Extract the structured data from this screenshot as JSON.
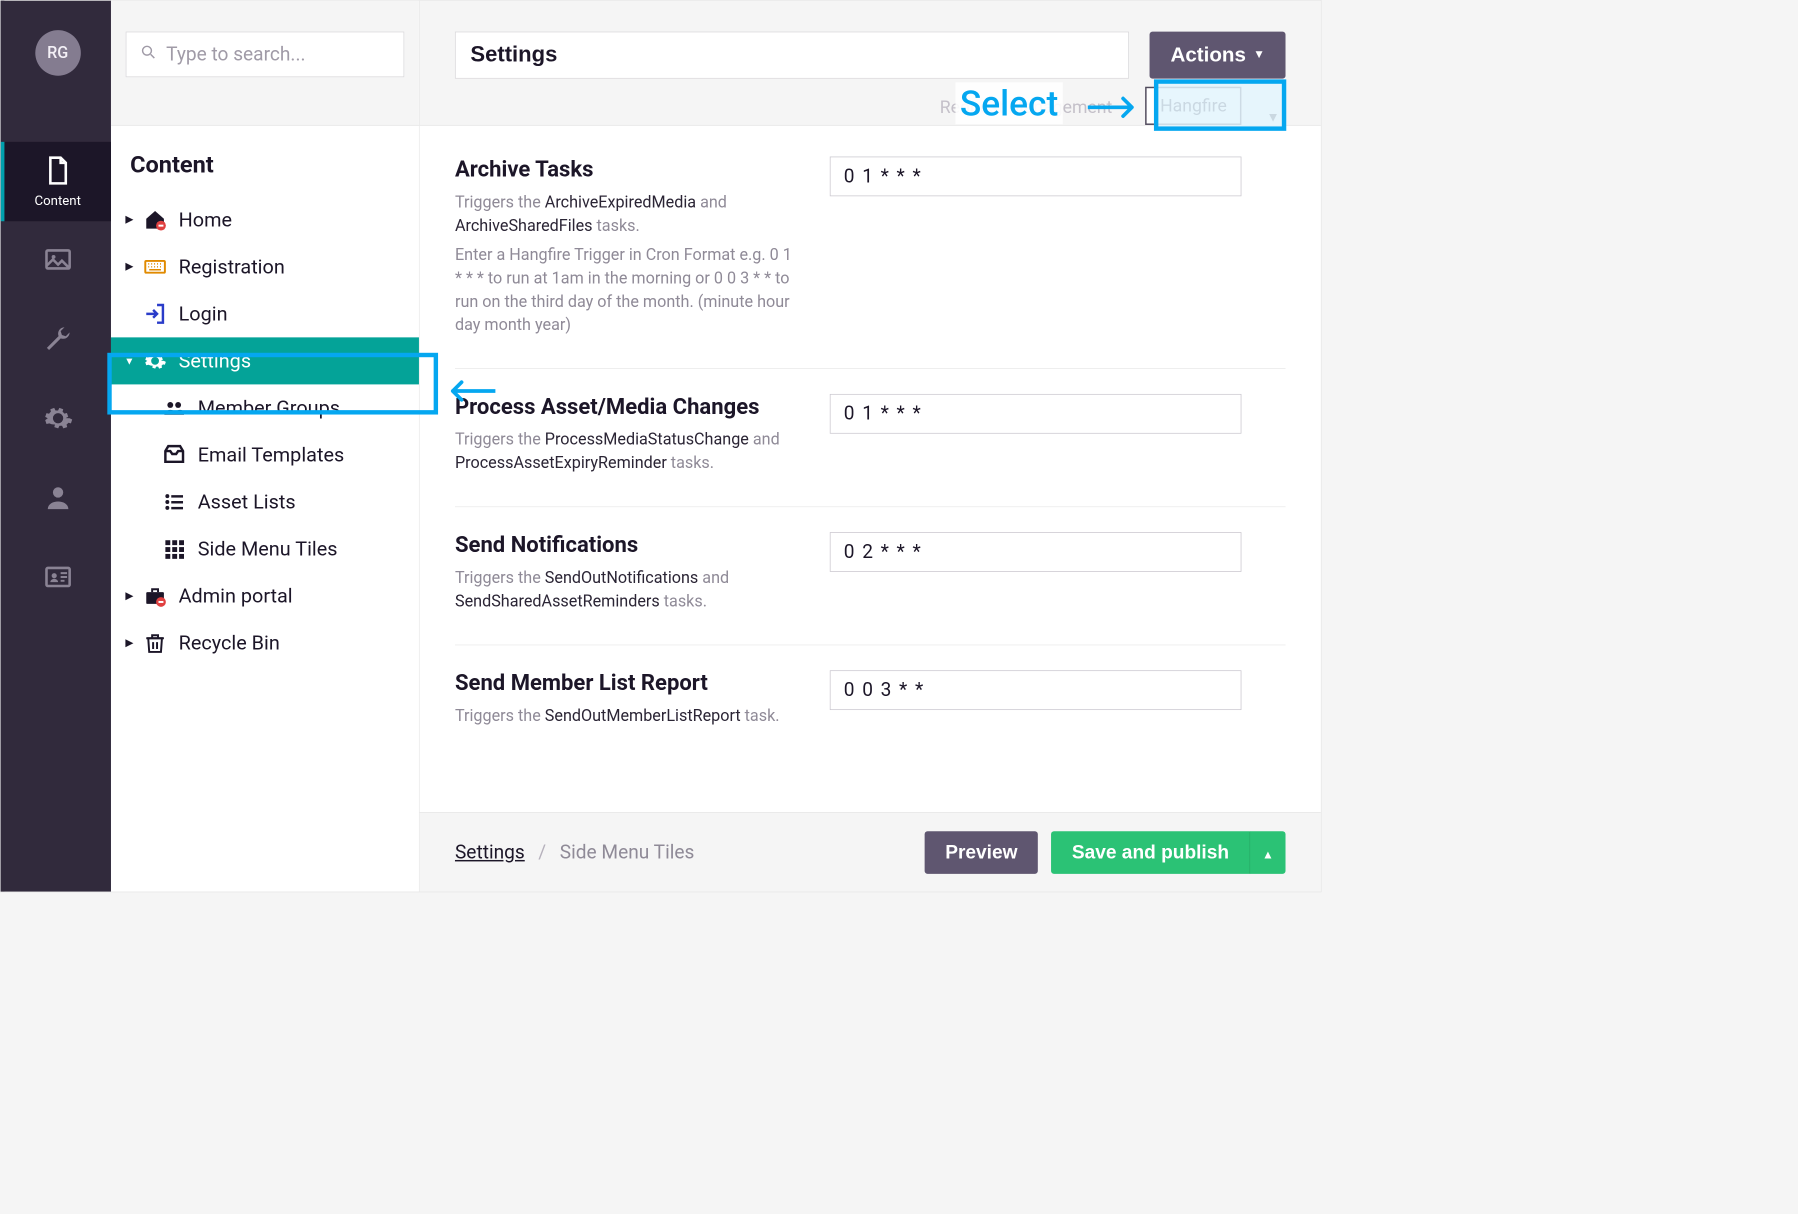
{
  "avatar": {
    "initials": "RG"
  },
  "rail": {
    "items": [
      {
        "id": "content",
        "label": "Content"
      },
      {
        "id": "media"
      },
      {
        "id": "settings-tool"
      },
      {
        "id": "config"
      },
      {
        "id": "users"
      },
      {
        "id": "members"
      }
    ]
  },
  "search": {
    "placeholder": "Type to search..."
  },
  "tree": {
    "title": "Content",
    "items": [
      {
        "label": "Home"
      },
      {
        "label": "Registration"
      },
      {
        "label": "Login"
      },
      {
        "label": "Settings",
        "selected": true
      },
      {
        "label": "Member Groups"
      },
      {
        "label": "Email Templates"
      },
      {
        "label": "Asset Lists"
      },
      {
        "label": "Side Menu Tiles"
      },
      {
        "label": "Admin portal"
      },
      {
        "label": "Recycle Bin"
      }
    ]
  },
  "page": {
    "title": "Settings",
    "actions_label": "Actions",
    "tabs": {
      "request_management": "Request Management",
      "hangfire": "Hangfire"
    },
    "fields": [
      {
        "heading": "Archive Tasks",
        "desc_pre": "Triggers the ",
        "desc_code1": "ArchiveExpiredMedia",
        "desc_mid": " and ",
        "desc_code2": "ArchiveSharedFiles",
        "desc_post": " tasks.",
        "hint": "Enter a Hangfire Trigger in Cron Format e.g. 0 1 * * * to run at 1am in the morning or 0 0 3 * * to run on the third day of the month. (minute hour day month year)",
        "value": "0 1 * * *"
      },
      {
        "heading": "Process Asset/Media Changes",
        "desc_pre": "Triggers the ",
        "desc_code1": "ProcessMediaStatusChange",
        "desc_mid": " and ",
        "desc_code2": "ProcessAssetExpiryReminder",
        "desc_post": " tasks.",
        "value": "0 1 * * *"
      },
      {
        "heading": "Send Notifications",
        "desc_pre": "Triggers the ",
        "desc_code1": "SendOutNotifications",
        "desc_mid": " and ",
        "desc_code2": "SendSharedAssetReminders",
        "desc_post": " tasks.",
        "value": "0 2 * * *"
      },
      {
        "heading": "Send Member List Report",
        "desc_pre": "Triggers the ",
        "desc_code1": "SendOutMemberListReport",
        "desc_mid": "",
        "desc_code2": "",
        "desc_post": " task.",
        "value": "0 0 3 * *"
      }
    ],
    "breadcrumb": {
      "root": "Settings",
      "current": "Side Menu Tiles"
    },
    "preview_label": "Preview",
    "save_label": "Save and publish"
  },
  "annotation": {
    "select_label": "Select"
  }
}
